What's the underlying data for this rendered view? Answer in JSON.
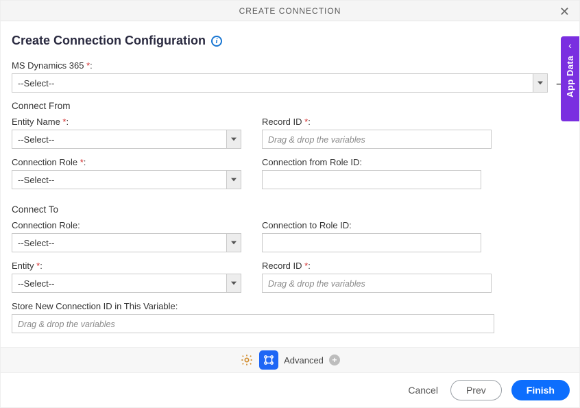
{
  "titlebar": {
    "text": "CREATE CONNECTION"
  },
  "sidetab": {
    "label": "App Data"
  },
  "page": {
    "title": "Create Connection Configuration"
  },
  "fields": {
    "ms_dynamics": {
      "label": "MS Dynamics 365 ",
      "value": "--Select--"
    },
    "connect_from_section": "Connect From",
    "entity_name": {
      "label": "Entity Name ",
      "value": "--Select--"
    },
    "record_id_from": {
      "label": "Record ID ",
      "placeholder": "Drag & drop the variables"
    },
    "connection_role_from": {
      "label": "Connection Role ",
      "value": "--Select--"
    },
    "connection_from_role_id": {
      "label": "Connection from Role ID:"
    },
    "connect_to_section": "Connect To",
    "connection_role_to": {
      "label": "Connection Role:",
      "value": "--Select--"
    },
    "connection_to_role_id": {
      "label": "Connection to Role ID:"
    },
    "entity_to": {
      "label": "Entity ",
      "value": "--Select--"
    },
    "record_id_to": {
      "label": "Record ID ",
      "placeholder": "Drag & drop the variables"
    },
    "store_var": {
      "label": "Store New Connection ID in This Variable:",
      "placeholder": "Drag & drop the variables"
    }
  },
  "advanced": {
    "label": "Advanced"
  },
  "buttons": {
    "cancel": "Cancel",
    "prev": "Prev",
    "finish": "Finish"
  },
  "req_marker": "*"
}
